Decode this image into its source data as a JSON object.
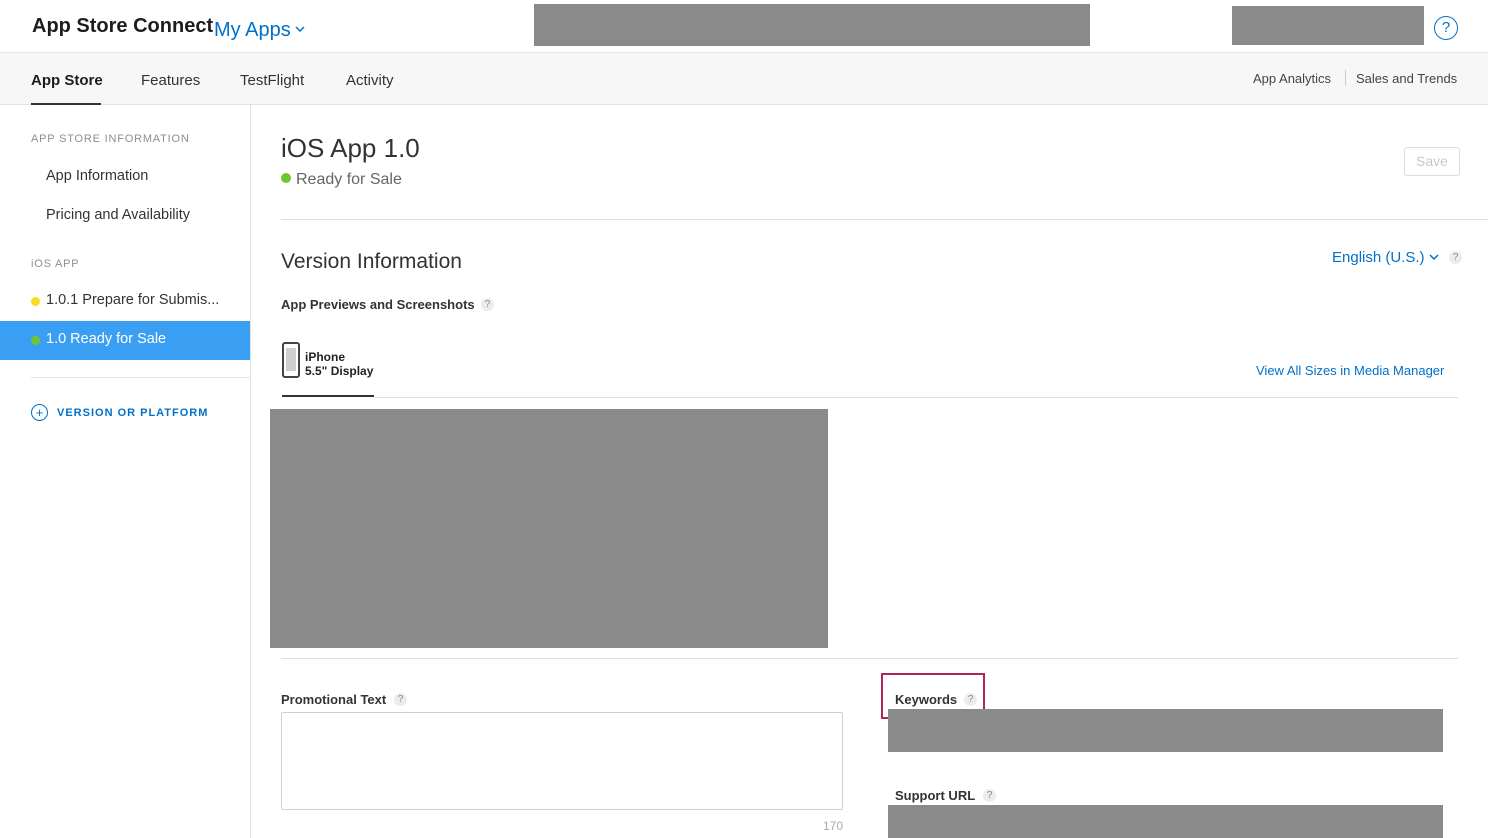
{
  "topbar": {
    "brand": "App Store Connect",
    "my_apps": "My Apps",
    "help_glyph": "?"
  },
  "nav": {
    "tabs": [
      "App Store",
      "Features",
      "TestFlight",
      "Activity"
    ],
    "active_tab": "App Store",
    "right_links": [
      "App Analytics",
      "Sales and Trends"
    ]
  },
  "sidebar": {
    "section_app_store": "APP STORE INFORMATION",
    "app_store_items": [
      "App Information",
      "Pricing and Availability"
    ],
    "section_ios": "iOS APP",
    "versions": [
      {
        "label": "1.0.1 Prepare for Submis...",
        "status_color": "#f5dc1e"
      },
      {
        "label": "1.0 Ready for Sale",
        "status_color": "#6ec531",
        "selected": true
      }
    ],
    "add_version_label": "VERSION OR PLATFORM"
  },
  "main": {
    "title": "iOS App 1.0",
    "status": "Ready for Sale",
    "status_color": "#6ec531",
    "save_label": "Save",
    "section_title": "Version Information",
    "language": "English (U.S.)",
    "help_glyph": "?",
    "previews_label": "App Previews and Screenshots",
    "device_name": "iPhone",
    "device_size": "5.5\" Display",
    "view_all_link": "View All Sizes in Media Manager",
    "promo_label": "Promotional Text",
    "promo_value": "",
    "promo_char_count": "170",
    "keywords_label": "Keywords",
    "support_label": "Support URL"
  },
  "colors": {
    "accent": "#0070c9",
    "selected_bg": "#3a9ff2",
    "highlight_box": "#b0245e",
    "redaction": "#8a8a8a"
  }
}
